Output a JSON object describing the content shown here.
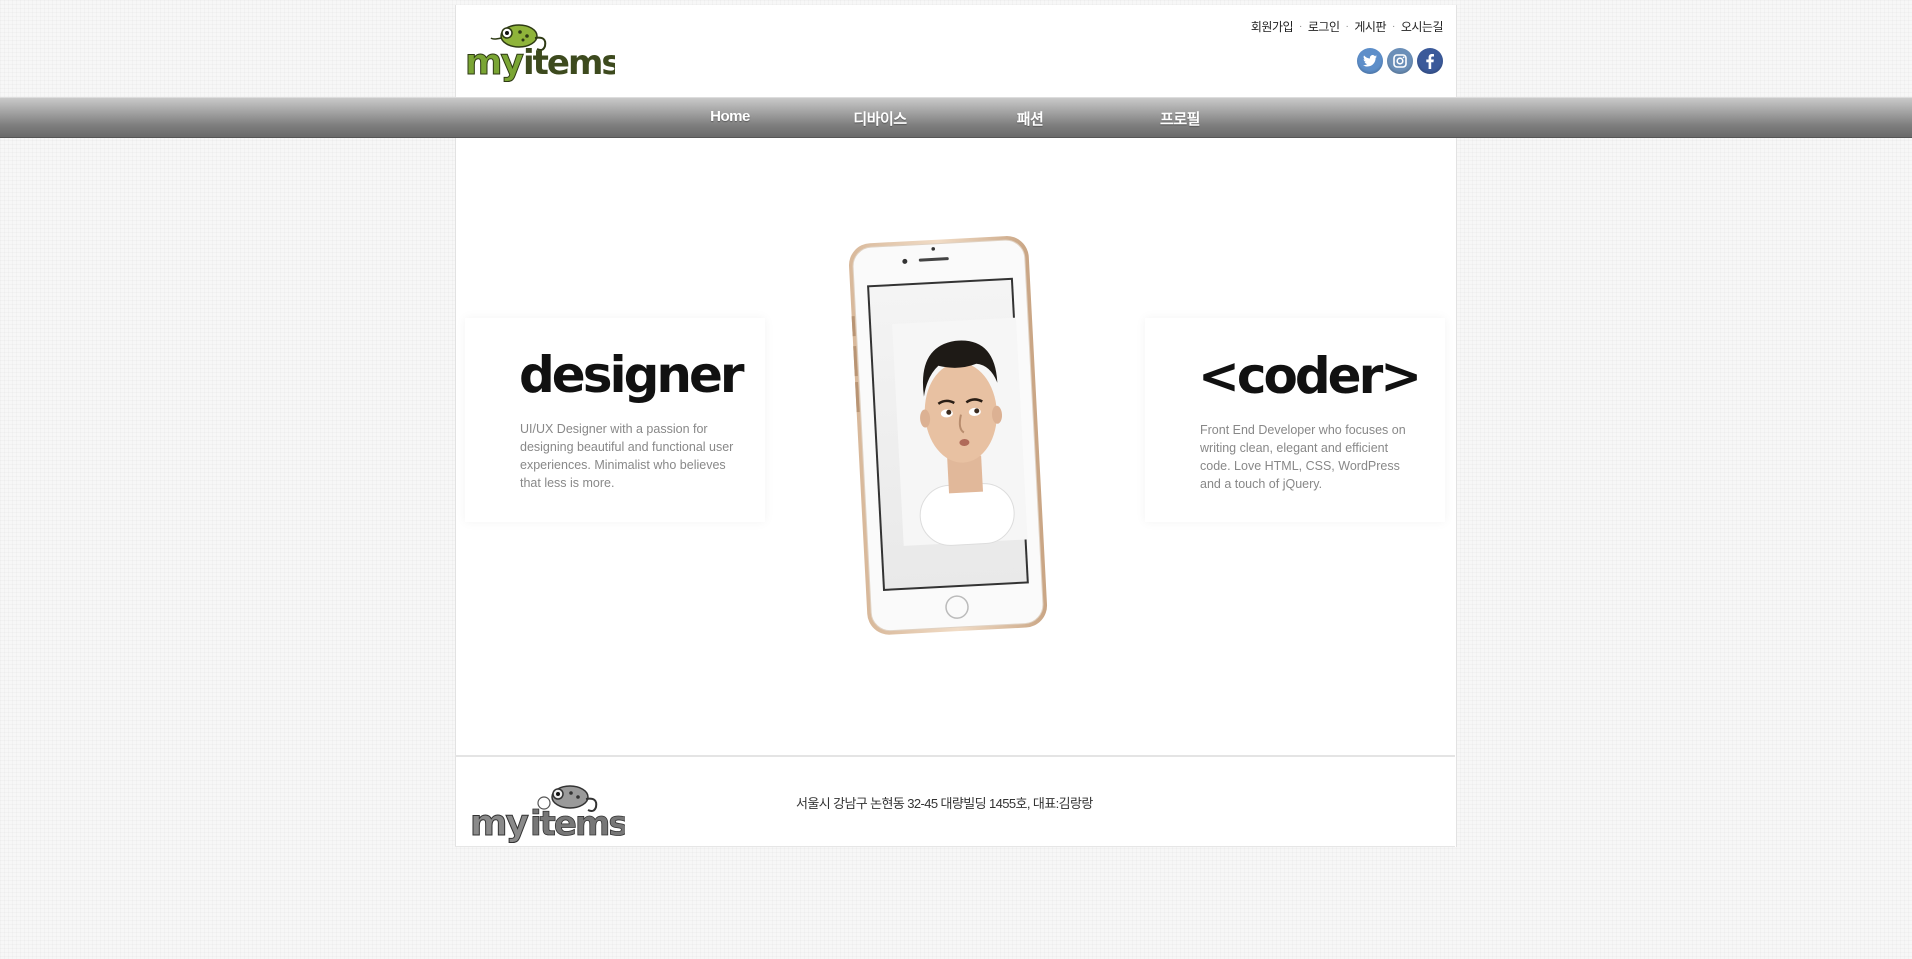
{
  "header": {
    "logo_text": "my items",
    "util_links": [
      "회원가입",
      "로그인",
      "게시판",
      "오시는길"
    ],
    "social": [
      {
        "icon": "twitter-icon",
        "glyph": "t",
        "color": "#5d8ec9"
      },
      {
        "icon": "instagram-icon",
        "glyph": "◘",
        "color": "#6b8fb8"
      },
      {
        "icon": "facebook-icon",
        "glyph": "f",
        "color": "#3b5a9a"
      }
    ]
  },
  "nav": {
    "items": [
      "Home",
      "디바이스",
      "패션",
      "프로필"
    ]
  },
  "hero": {
    "left": {
      "title": "designer",
      "description": "UI/UX Designer with a passion for designing beautiful and functional user experiences. Minimalist who believes that less is more."
    },
    "right": {
      "title": "<coder>",
      "description": "Front End Developer who focuses on writing clean, elegant and efficient code. Love HTML, CSS, WordPress and a touch of jQuery."
    }
  },
  "footer": {
    "logo_text": "my items",
    "address": "서울시 강남구 논현동 32-45 대량빌딩 1455호, 대표:김랑랑"
  },
  "colors": {
    "nav_top": "#c9c9c9",
    "nav_bottom": "#6a6a6a",
    "logo_green": "#7aa534",
    "logo_dark": "#3d4a1e"
  }
}
